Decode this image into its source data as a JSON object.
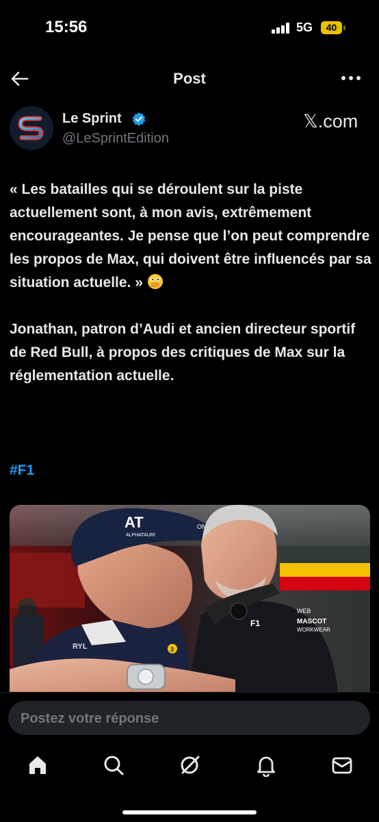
{
  "status_bar": {
    "time": "15:56",
    "network": "5G",
    "battery": "40"
  },
  "header": {
    "title": "Post"
  },
  "author": {
    "name": "Le Sprint",
    "handle": "@LeSprintEdition",
    "source": "𝕏.com",
    "avatar_letter": "S"
  },
  "post": {
    "paragraph_1": "« Les batailles qui se déroulent sur la piste actuellement sont, à mon avis, extrêmement encourageantes. Je pense que l’on peut comprendre les propos de Max, qui doivent être influencés par sa situation actuelle. »",
    "paragraph_2": "Jonathan, patron d’Audi et ancien directeur sportif de Red Bull, à propos des critiques de Max sur la réglementation actuelle.",
    "hashtag": "#F1",
    "emoji": "face-with-open-eyes-and-hand-over-mouth"
  },
  "image_text": {
    "cap_logo": "AT",
    "cap_sub": "ALPHATAURI",
    "cap_side": "ON",
    "jacket_line_1": "WEB",
    "jacket_line_2": "MASCOT",
    "jacket_line_3": "WORKWEAR",
    "jacket_emblem": "F1",
    "shirt_text_1": "RYL",
    "shirt_text_2": "3"
  },
  "reply": {
    "placeholder": "Postez votre réponse"
  },
  "nav": {
    "items": [
      {
        "icon": "home-icon"
      },
      {
        "icon": "search-icon"
      },
      {
        "icon": "grok-icon"
      },
      {
        "icon": "bell-icon"
      },
      {
        "icon": "mail-icon"
      }
    ]
  },
  "colors": {
    "accent": "#1d9bf0",
    "background": "#000000",
    "text": "#e7e9ea",
    "muted": "#71767b",
    "battery": "#e6c200"
  }
}
